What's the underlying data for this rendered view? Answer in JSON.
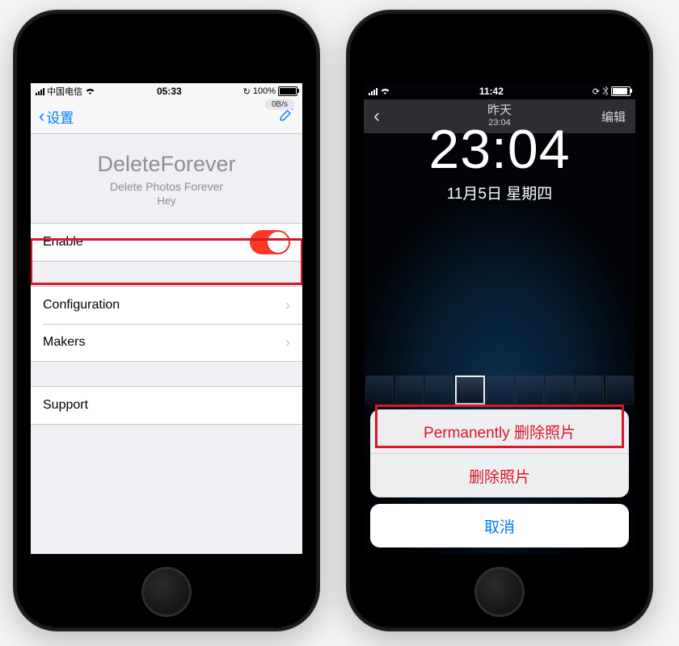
{
  "leftPhone": {
    "statusBar": {
      "carrier": "中国电信",
      "time": "05:33",
      "batteryPercent": "100%",
      "speedBadge": "0B/s",
      "refreshIcon": "↻"
    },
    "nav": {
      "back": "设置",
      "composeIcon": "compose"
    },
    "hero": {
      "title": "DeleteForever",
      "subtitle": "Delete Photos Forever",
      "subtitle2": "Hey"
    },
    "rows": {
      "enable": "Enable",
      "configuration": "Configuration",
      "makers": "Makers",
      "support": "Support"
    }
  },
  "rightPhone": {
    "statusBar": {
      "time": "11:42"
    },
    "nav": {
      "back": "〈",
      "title": "昨天",
      "subtitle": "23:04",
      "edit": "编辑"
    },
    "lockTime": "23:04",
    "lockDate": "11月5日 星期四",
    "sheet": {
      "permDelete": "Permanently 删除照片",
      "delete": "删除照片",
      "cancel": "取消"
    }
  }
}
